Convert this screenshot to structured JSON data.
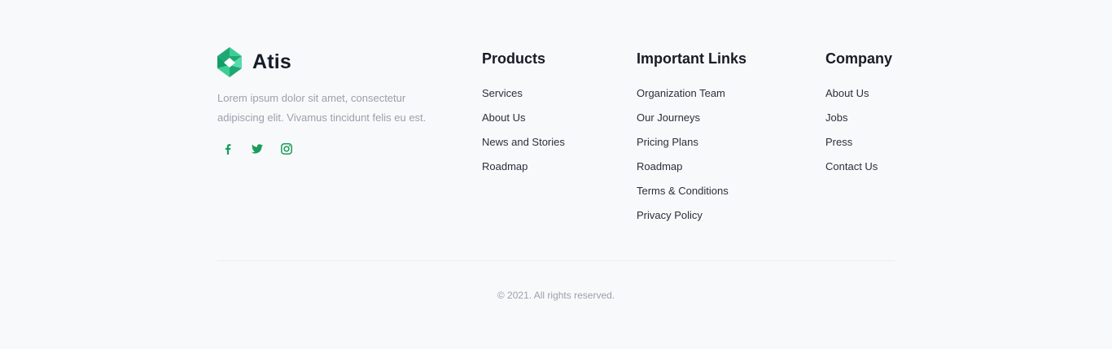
{
  "brand": {
    "name": "Atis",
    "description": "Lorem ipsum dolor sit amet, consectetur adipiscing elit. Vivamus tincidunt felis eu est.",
    "accent_color": "#1a9c5a",
    "logo_light": "#3dd39a",
    "logo_dark": "#139d6b"
  },
  "social": [
    {
      "icon": "facebook-icon"
    },
    {
      "icon": "twitter-icon"
    },
    {
      "icon": "instagram-icon"
    }
  ],
  "columns": {
    "products": {
      "title": "Products",
      "items": [
        "Services",
        "About Us",
        "News and Stories",
        "Roadmap"
      ]
    },
    "important_links": {
      "title": "Important Links",
      "items": [
        "Organization Team",
        "Our Journeys",
        "Pricing Plans",
        "Roadmap",
        "Terms & Conditions",
        "Privacy Policy"
      ]
    },
    "company": {
      "title": "Company",
      "items": [
        "About Us",
        "Jobs",
        "Press",
        "Contact Us"
      ]
    }
  },
  "copyright": "© 2021. All rights reserved."
}
